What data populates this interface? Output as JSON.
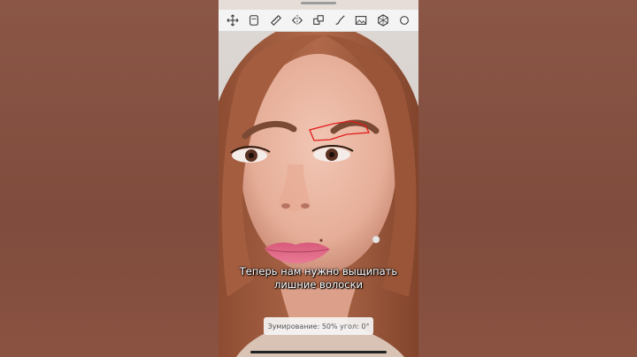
{
  "toolbar": {
    "tools": [
      {
        "icon": "move-icon"
      },
      {
        "icon": "layer-icon"
      },
      {
        "icon": "ruler-icon"
      },
      {
        "icon": "flip-icon"
      },
      {
        "icon": "transform-icon"
      },
      {
        "icon": "brush-icon"
      },
      {
        "icon": "image-icon"
      },
      {
        "icon": "grid-icon"
      },
      {
        "icon": "more-icon"
      }
    ]
  },
  "caption": {
    "line1": "Теперь нам нужно выщипать",
    "line2": "лишние волоски"
  },
  "zoom_status": {
    "text": "Зумирование: 50%   угол: 0°"
  },
  "colors": {
    "background": "#8a5443",
    "selection_outline": "#e21b1b",
    "toolbar": "#f4f4f4"
  }
}
